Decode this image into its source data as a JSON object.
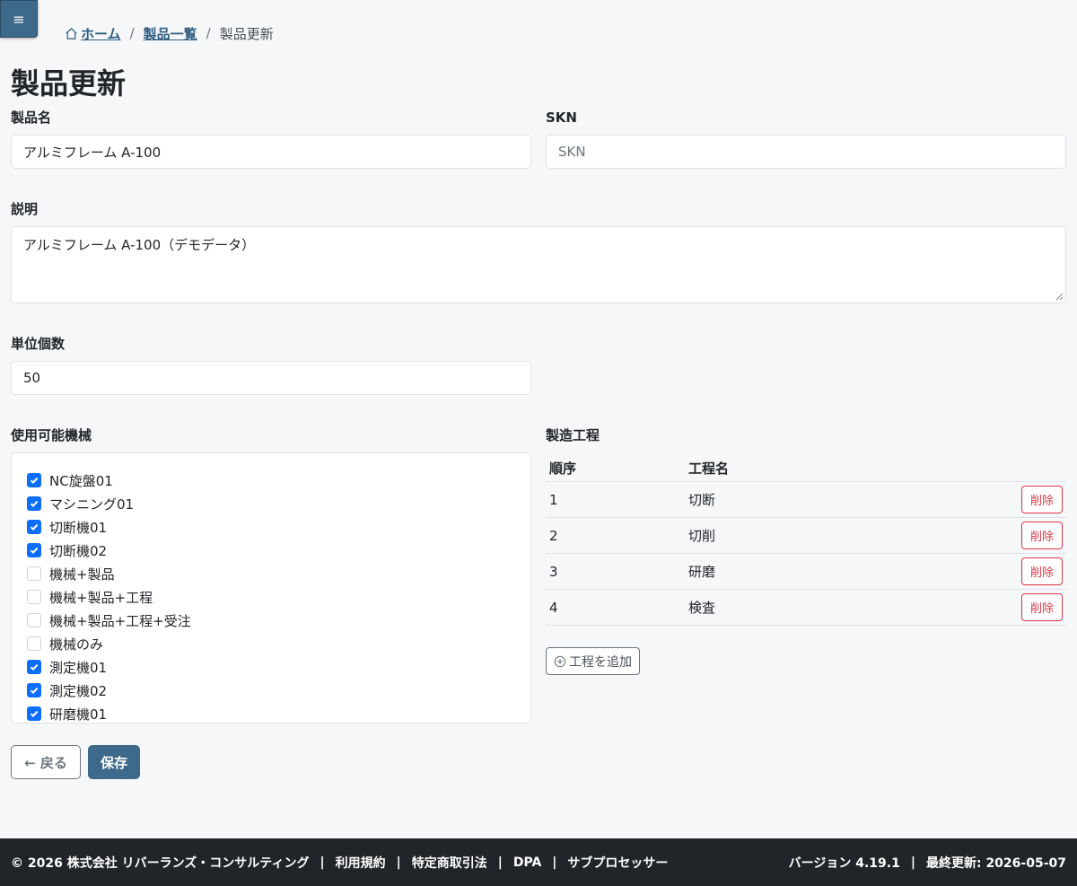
{
  "menu": {
    "icon": "≡"
  },
  "breadcrumb": {
    "home": "ホーム",
    "list": "製品一覧",
    "current": "製品更新"
  },
  "page_title": "製品更新",
  "form": {
    "product_name_label": "製品名",
    "product_name_value": "アルミフレーム A-100",
    "skn_label": "SKN",
    "skn_placeholder": "SKN",
    "description_label": "説明",
    "description_value": "アルミフレーム A-100（デモデータ）",
    "unit_label": "単位個数",
    "unit_value": "50",
    "machines_label": "使用可能機械",
    "machines": [
      {
        "label": "NC旋盤01",
        "checked": true
      },
      {
        "label": "マシニング01",
        "checked": true
      },
      {
        "label": "切断機01",
        "checked": true
      },
      {
        "label": "切断機02",
        "checked": true
      },
      {
        "label": "機械+製品",
        "checked": false
      },
      {
        "label": "機械+製品+工程",
        "checked": false
      },
      {
        "label": "機械+製品+工程+受注",
        "checked": false
      },
      {
        "label": "機械のみ",
        "checked": false
      },
      {
        "label": "測定機01",
        "checked": true
      },
      {
        "label": "測定機02",
        "checked": true
      },
      {
        "label": "研磨機01",
        "checked": true
      }
    ],
    "process_label": "製造工程",
    "process_headers": {
      "order": "順序",
      "name": "工程名"
    },
    "processes": [
      {
        "order": "1",
        "name": "切断",
        "delete": "削除"
      },
      {
        "order": "2",
        "name": "切削",
        "delete": "削除"
      },
      {
        "order": "3",
        "name": "研磨",
        "delete": "削除"
      },
      {
        "order": "4",
        "name": "検査",
        "delete": "削除"
      }
    ],
    "add_process": "工程を追加",
    "back": "← 戻る",
    "save": "保存"
  },
  "footer": {
    "copyright": "© 2026 株式会社 リバーランズ・コンサルティング",
    "links": [
      "利用規約",
      "特定商取引法",
      "DPA",
      "サブプロセッサー"
    ],
    "version": "バージョン 4.19.1",
    "updated": "最終更新: 2026-05-07",
    "separator": "|"
  },
  "colors": {
    "primary": "#3d6a8a",
    "danger": "#dc3545",
    "checkbox": "#0d6efd",
    "footer": "#212529"
  }
}
